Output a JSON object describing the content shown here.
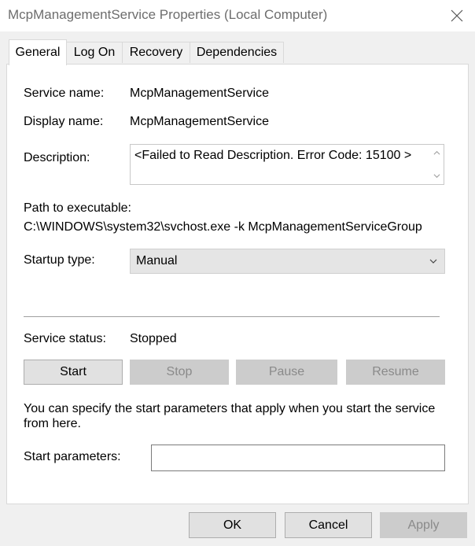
{
  "window": {
    "title": "McpManagementService Properties (Local Computer)"
  },
  "tabs": [
    {
      "label": "General",
      "active": true
    },
    {
      "label": "Log On"
    },
    {
      "label": "Recovery"
    },
    {
      "label": "Dependencies"
    }
  ],
  "general": {
    "service_name_label": "Service name:",
    "service_name_value": "McpManagementService",
    "display_name_label": "Display name:",
    "display_name_value": "McpManagementService",
    "description_label": "Description:",
    "description_value": "<Failed to Read Description. Error Code: 15100 >",
    "path_label": "Path to executable:",
    "path_value": "C:\\WINDOWS\\system32\\svchost.exe -k McpManagementServiceGroup",
    "startup_type_label": "Startup type:",
    "startup_type_value": "Manual",
    "service_status_label": "Service status:",
    "service_status_value": "Stopped",
    "buttons": {
      "start": "Start",
      "stop": "Stop",
      "pause": "Pause",
      "resume": "Resume"
    },
    "help_text": "You can specify the start parameters that apply when you start the service from here.",
    "start_params_label": "Start parameters:",
    "start_params_value": ""
  },
  "dialog_buttons": {
    "ok": "OK",
    "cancel": "Cancel",
    "apply": "Apply"
  },
  "icons": {
    "close": "close-icon",
    "scroll_up": "scroll-up-icon",
    "scroll_down": "scroll-down-icon",
    "dropdown": "chevron-down-icon"
  },
  "colors": {
    "window_bg": "#f0f0f0",
    "panel_bg": "#ffffff",
    "disabled_button_bg": "#cccccc",
    "disabled_text": "#8a8a8a"
  }
}
